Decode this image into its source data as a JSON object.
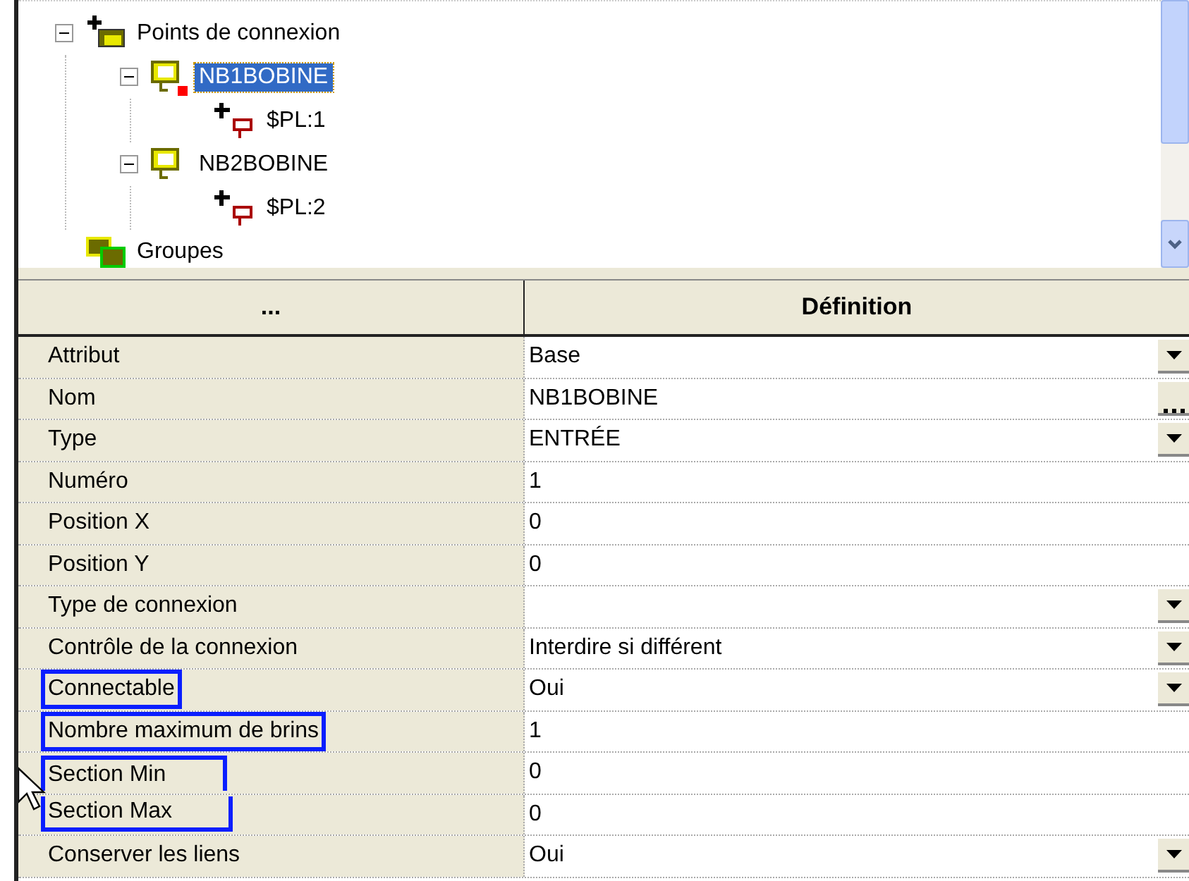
{
  "tree": {
    "items": [
      {
        "label": "Points de connexion",
        "kind": "pin-group",
        "expanded": true,
        "selected": false,
        "children": [
          {
            "label": "NB1BOBINE",
            "kind": "pin-error",
            "expanded": true,
            "selected": true,
            "children": [
              {
                "label": "$PL:1",
                "kind": "pin-point",
                "selected": false
              }
            ]
          },
          {
            "label": "NB2BOBINE",
            "kind": "pin",
            "expanded": true,
            "selected": false,
            "children": [
              {
                "label": "$PL:2",
                "kind": "pin-point",
                "selected": false
              }
            ]
          }
        ]
      },
      {
        "label": "Groupes",
        "kind": "group",
        "selected": false
      }
    ]
  },
  "grid": {
    "columns": [
      "...",
      "Définition"
    ],
    "rows": [
      {
        "name": "Attribut",
        "value": "Base",
        "kind": "dropdown",
        "highlighted": false,
        "box_joined_below": false
      },
      {
        "name": "Nom",
        "value": "NB1BOBINE",
        "kind": "ellipsis",
        "highlighted": false,
        "box_joined_below": false
      },
      {
        "name": "Type",
        "value": "ENTRÉE",
        "kind": "dropdown",
        "highlighted": false,
        "box_joined_below": false
      },
      {
        "name": "Numéro",
        "value": "1",
        "kind": "text",
        "highlighted": false,
        "box_joined_below": false
      },
      {
        "name": "Position X",
        "value": "0",
        "kind": "text",
        "highlighted": false,
        "box_joined_below": false
      },
      {
        "name": "Position Y",
        "value": "0",
        "kind": "text",
        "highlighted": false,
        "box_joined_below": false
      },
      {
        "name": "Type de connexion",
        "kind": "dropdown",
        "highlighted": false,
        "box_joined_below": false
      },
      {
        "name": "Contrôle de la connexion",
        "value": "Interdire si différent",
        "kind": "dropdown",
        "highlighted": false,
        "box_joined_below": false
      },
      {
        "name": "Connectable",
        "value": "Oui",
        "kind": "dropdown",
        "highlighted": true,
        "box_joined_below": false
      },
      {
        "name": "Nombre maximum de brins",
        "value": "1",
        "kind": "text",
        "highlighted": true,
        "box_joined_below": false
      },
      {
        "name": "Section Min",
        "value": "0",
        "kind": "text",
        "highlighted": true,
        "box_joined_below": true
      },
      {
        "name": "Section Max",
        "value": "0",
        "kind": "text",
        "highlighted": true,
        "box_joined_below": false
      },
      {
        "name": "Conserver les liens",
        "value": "Oui",
        "kind": "dropdown",
        "highlighted": false,
        "box_joined_below": false
      }
    ]
  }
}
